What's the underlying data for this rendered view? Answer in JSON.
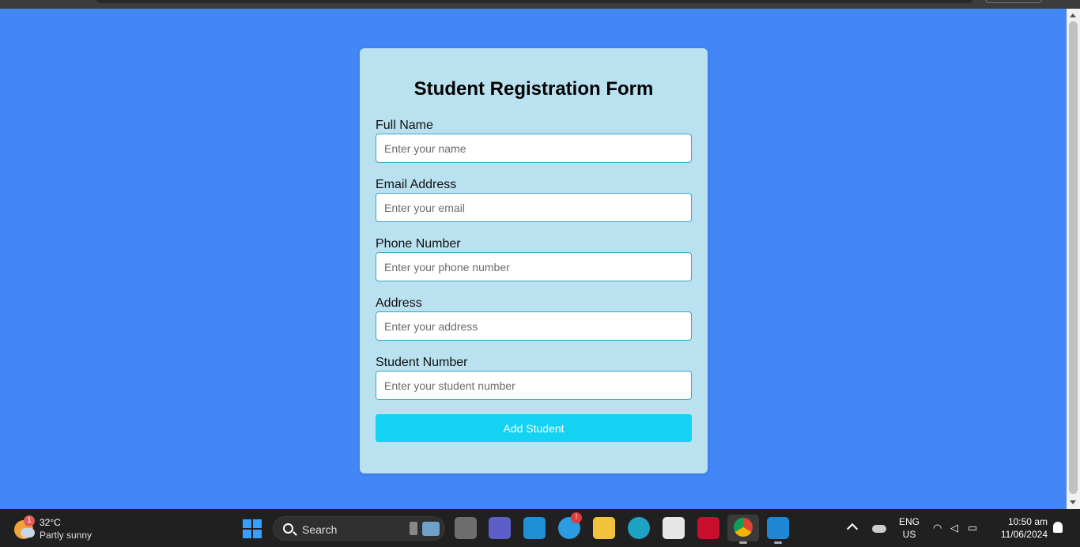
{
  "form": {
    "title": "Student Registration Form",
    "fields": [
      {
        "label": "Full Name",
        "placeholder": "Enter your name"
      },
      {
        "label": "Email Address",
        "placeholder": "Enter your email"
      },
      {
        "label": "Phone Number",
        "placeholder": "Enter your phone number"
      },
      {
        "label": "Address",
        "placeholder": "Enter your address"
      },
      {
        "label": "Student Number",
        "placeholder": "Enter your student number"
      }
    ],
    "submit_label": "Add Student"
  },
  "taskbar": {
    "weather": {
      "temp": "32°C",
      "desc": "Partly sunny",
      "badge": "1"
    },
    "search_label": "Search",
    "language": {
      "line1": "ENG",
      "line2": "US"
    },
    "clock": {
      "time": "10:50 am",
      "date": "11/06/2024"
    },
    "alert_badge": "!"
  },
  "colors": {
    "page_bg": "#4287f5",
    "card_bg": "#b9e1ef",
    "button_bg": "#13d2f2"
  }
}
